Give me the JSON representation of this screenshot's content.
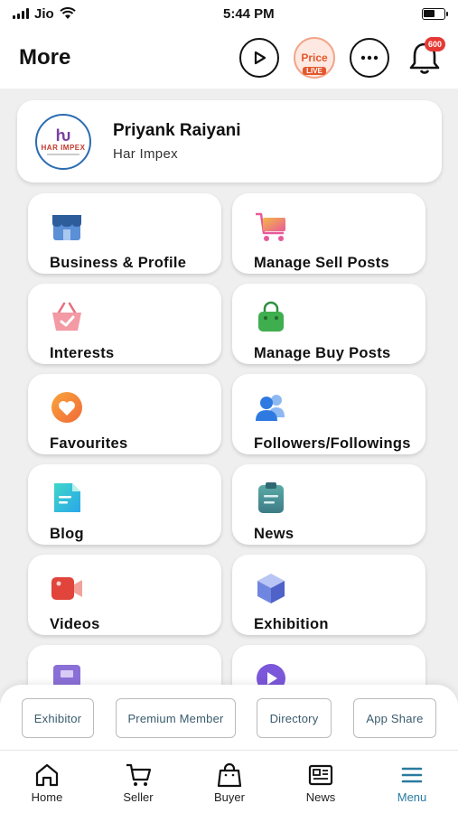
{
  "status": {
    "carrier": "Jio",
    "time": "5:44 PM"
  },
  "header": {
    "title": "More",
    "price_label": "Price",
    "live_label": "LIVE",
    "notification_count": "600"
  },
  "profile": {
    "logo_text": "HAR IMPEX",
    "name": "Priyank Raiyani",
    "company": "Har Impex"
  },
  "tiles": [
    {
      "label": "Business & Profile",
      "icon": "store-icon"
    },
    {
      "label": "Manage Sell Posts",
      "icon": "cart-icon"
    },
    {
      "label": "Interests",
      "icon": "basket-icon"
    },
    {
      "label": "Manage Buy Posts",
      "icon": "shopping-bag-icon"
    },
    {
      "label": "Favourites",
      "icon": "heart-icon"
    },
    {
      "label": "Followers/Followings",
      "icon": "users-icon"
    },
    {
      "label": "Blog",
      "icon": "document-icon"
    },
    {
      "label": "News",
      "icon": "clipboard-icon"
    },
    {
      "label": "Videos",
      "icon": "video-camera-icon"
    },
    {
      "label": "Exhibition",
      "icon": "cube-icon"
    }
  ],
  "chips": [
    "Exhibitor",
    "Premium Member",
    "Directory",
    "App Share"
  ],
  "tabs": [
    {
      "label": "Home",
      "icon": "home-icon"
    },
    {
      "label": "Seller",
      "icon": "cart-icon"
    },
    {
      "label": "Buyer",
      "icon": "bag-icon"
    },
    {
      "label": "News",
      "icon": "newspaper-icon"
    },
    {
      "label": "Menu",
      "icon": "menu-icon",
      "active": true
    }
  ],
  "colors": {
    "accent": "#2a7a9f",
    "badge": "#e53935",
    "live": "#e4572e"
  }
}
